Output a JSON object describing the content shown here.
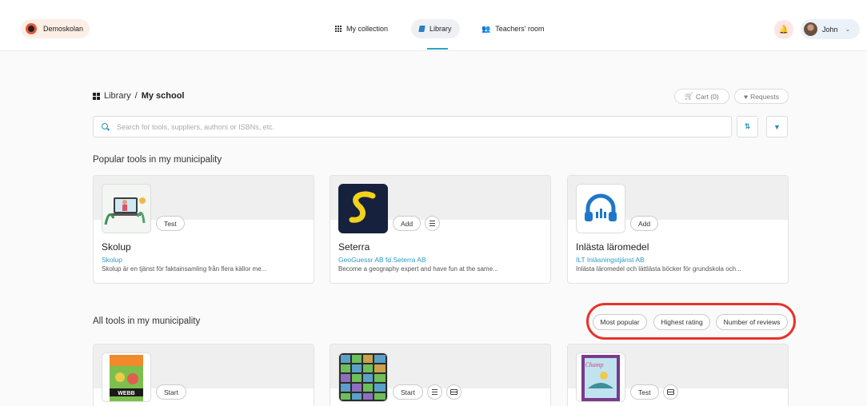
{
  "header": {
    "school_name": "Demoskolan",
    "nav": [
      {
        "label": "My collection"
      },
      {
        "label": "Library"
      },
      {
        "label": "Teachers' room"
      }
    ],
    "user_name": "John",
    "accent": "#2aa5c7"
  },
  "breadcrumb": {
    "root": "Library",
    "separator": "/",
    "current": "My school"
  },
  "actions": {
    "cart": "Cart (0)",
    "requests": "Requests"
  },
  "search": {
    "placeholder": "Search for tools, suppliers, authors or ISBNs, etc.",
    "value": ""
  },
  "popular": {
    "title": "Popular tools in my municipality",
    "cards": [
      {
        "title": "Skolup",
        "supplier": "Skolup",
        "description": "Skolup är en tjänst för faktainsamling från flera källor me...",
        "action": "Test"
      },
      {
        "title": "Seterra",
        "supplier": "GeoGuessr AB fd.Seterra AB",
        "description": "Become a geography expert and have fun at the same...",
        "action": "Add"
      },
      {
        "title": "Inlästa läromedel",
        "supplier": "ILT Inläsningstjänst AB",
        "description": "Inlästa läromedel och lättlästa böcker för grundskola och...",
        "action": "Add"
      }
    ]
  },
  "all_tools": {
    "title": "All tools in my municipality",
    "sort_options": [
      "Most popular",
      "Highest rating",
      "Number of reviews"
    ],
    "cards": [
      {
        "action": "Start",
        "thumb_text": "WEBB"
      },
      {
        "action": "Start"
      },
      {
        "action": "Test",
        "thumb_text": "Champ"
      }
    ]
  }
}
